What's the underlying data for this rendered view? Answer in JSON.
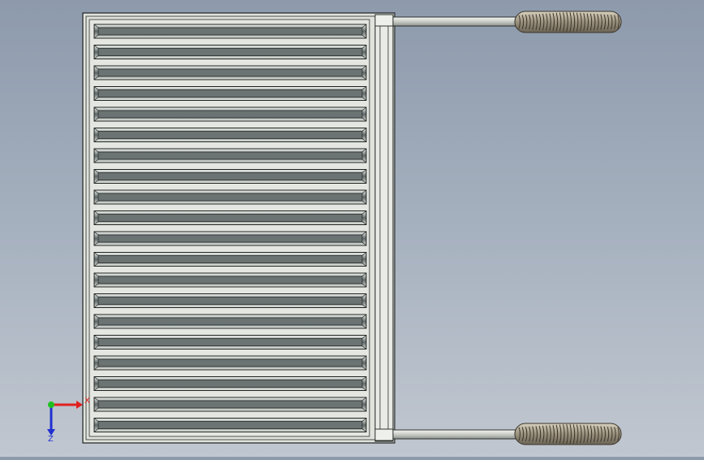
{
  "viewport": {
    "background_top": "#8d9aac",
    "background_bottom": "#c1c7d0",
    "model": {
      "name": "heat-exchanger-panel",
      "slat_count": 20,
      "rod_count": 2,
      "frame_color": "#dde2da",
      "slat_fill": "#6f7778",
      "edge_color": "#1e2220",
      "rod_color": "#d7dad5",
      "handle_color": "#a89f8c"
    }
  },
  "triad": {
    "x_label": "X",
    "z_label": "Z",
    "x_color": "#e02020",
    "y_color": "#20c020",
    "z_color": "#2030d0"
  }
}
